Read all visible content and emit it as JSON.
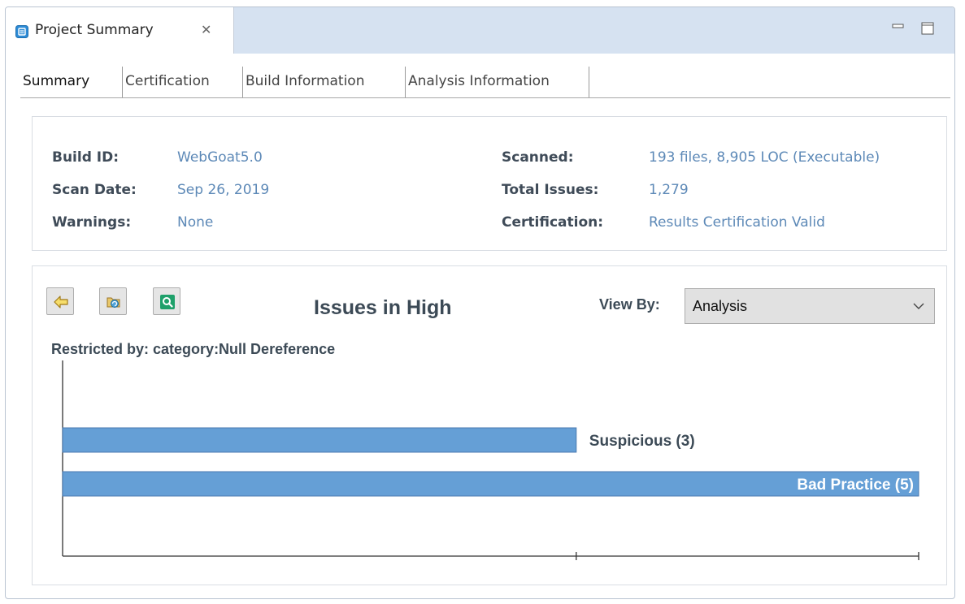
{
  "view": {
    "title": "Project Summary",
    "close_glyph": "✕",
    "icons": [
      "project-summary-icon",
      "close-icon",
      "minimize-icon",
      "maximize-icon"
    ]
  },
  "subtabs": [
    "Summary",
    "Certification",
    "Build Information",
    "Analysis Information"
  ],
  "info": {
    "build_id_label": "Build ID:",
    "build_id": "WebGoat5.0",
    "scan_date_label": "Scan Date:",
    "scan_date": "Sep 26, 2019",
    "warnings_label": "Warnings:",
    "warnings": "None",
    "scanned_label": "Scanned:",
    "scanned": "193 files, 8,905 LOC (Executable)",
    "total_issues_label": "Total Issues:",
    "total_issues": "1,279",
    "certification_label": "Certification:",
    "certification": "Results Certification Valid"
  },
  "chart_panel": {
    "title": "Issues in High",
    "view_by_label": "View By:",
    "view_by_value": "Analysis",
    "restricted_by": "Restricted by: category:Null Dereference",
    "toolbar_icons": [
      "back-arrow-icon",
      "folder-refresh-icon",
      "search-icon"
    ]
  },
  "colors": {
    "bar": "#659fd6",
    "bar_border": "#4a7ab0",
    "value_text": "#5d89b7",
    "label_text": "#3c4a56",
    "header_bg": "#d6e2f1"
  },
  "chart_data": {
    "type": "bar",
    "orientation": "horizontal",
    "categories": [
      "Suspicious",
      "Bad Practice"
    ],
    "values": [
      3,
      5
    ],
    "labels": [
      "Suspicious (3)",
      "Bad Practice (5)"
    ],
    "title": "Issues in High",
    "xlim": [
      0,
      5
    ],
    "grid": false
  }
}
